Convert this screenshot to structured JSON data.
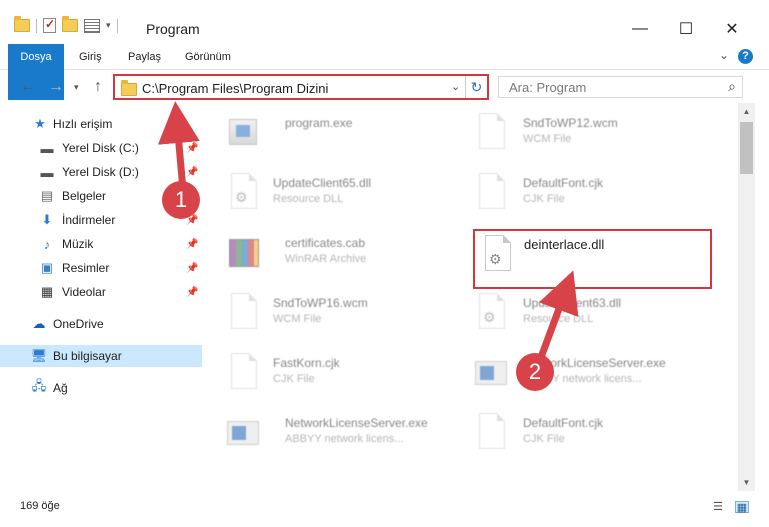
{
  "window": {
    "title": "Program",
    "controls": {
      "minimize": "—",
      "maximize": "☐",
      "close": "✕"
    }
  },
  "ribbon": {
    "tabs": [
      "Dosya",
      "Giriş",
      "Paylaş",
      "Görünüm"
    ],
    "help": "?"
  },
  "nav": {
    "address": "C:\\Program Files\\Program Dizini",
    "search_placeholder": "Ara: Program"
  },
  "sidebar": {
    "items": [
      {
        "label": "Hızlı erişim",
        "icon": "star-icon"
      },
      {
        "label": "Yerel Disk (C:)",
        "icon": "drive-icon",
        "pinned": true
      },
      {
        "label": "Yerel Disk (D:)",
        "icon": "drive-icon",
        "pinned": true
      },
      {
        "label": "Belgeler",
        "icon": "documents-icon",
        "pinned": true
      },
      {
        "label": "İndirmeler",
        "icon": "download-icon",
        "pinned": true
      },
      {
        "label": "Müzik",
        "icon": "music-icon",
        "pinned": true
      },
      {
        "label": "Resimler",
        "icon": "pictures-icon",
        "pinned": true
      },
      {
        "label": "Videolar",
        "icon": "videos-icon",
        "pinned": true
      },
      {
        "label": "OneDrive",
        "icon": "cloud-icon"
      },
      {
        "label": "Bu bilgisayar",
        "icon": "computer-icon",
        "selected": true
      },
      {
        "label": "Ağ",
        "icon": "network-icon"
      }
    ]
  },
  "files": [
    {
      "name": "program.exe",
      "type": "",
      "icon": "exe-icon"
    },
    {
      "name": "SndToWP12.wcm",
      "type": "WCM File",
      "icon": "file-icon"
    },
    {
      "name": "UpdateClient65.dll",
      "type": "Resource DLL",
      "icon": "dll-icon"
    },
    {
      "name": "DefaultFont.cjk",
      "type": "CJK File",
      "icon": "file-icon"
    },
    {
      "name": "certificates.cab",
      "type": "WinRAR Archive",
      "icon": "archive-icon"
    },
    {
      "name": "deinterlace.dll",
      "type": "",
      "icon": "dll-icon"
    },
    {
      "name": "SndToWP16.wcm",
      "type": "WCM File",
      "icon": "file-icon"
    },
    {
      "name": "UpdateClient63.dll",
      "type": "Resource DLL",
      "icon": "dll-icon"
    },
    {
      "name": "FastKorn.cjk",
      "type": "CJK File",
      "icon": "file-icon"
    },
    {
      "name": "NetworkLicenseServer.exe",
      "type": "ABBYY network licens...",
      "icon": "exe-icon"
    },
    {
      "name": "NetworkLicenseServer.exe",
      "type": "ABBYY network licens...",
      "icon": "exe-icon"
    },
    {
      "name": "DefaultFont.cjk",
      "type": "CJK File",
      "icon": "file-icon"
    }
  ],
  "status": {
    "count": "169 öğe"
  },
  "annotations": {
    "step1": "1",
    "step2": "2"
  },
  "colors": {
    "accent": "#1979ca",
    "highlight": "#d4373f",
    "annotation": "#d8434a"
  }
}
